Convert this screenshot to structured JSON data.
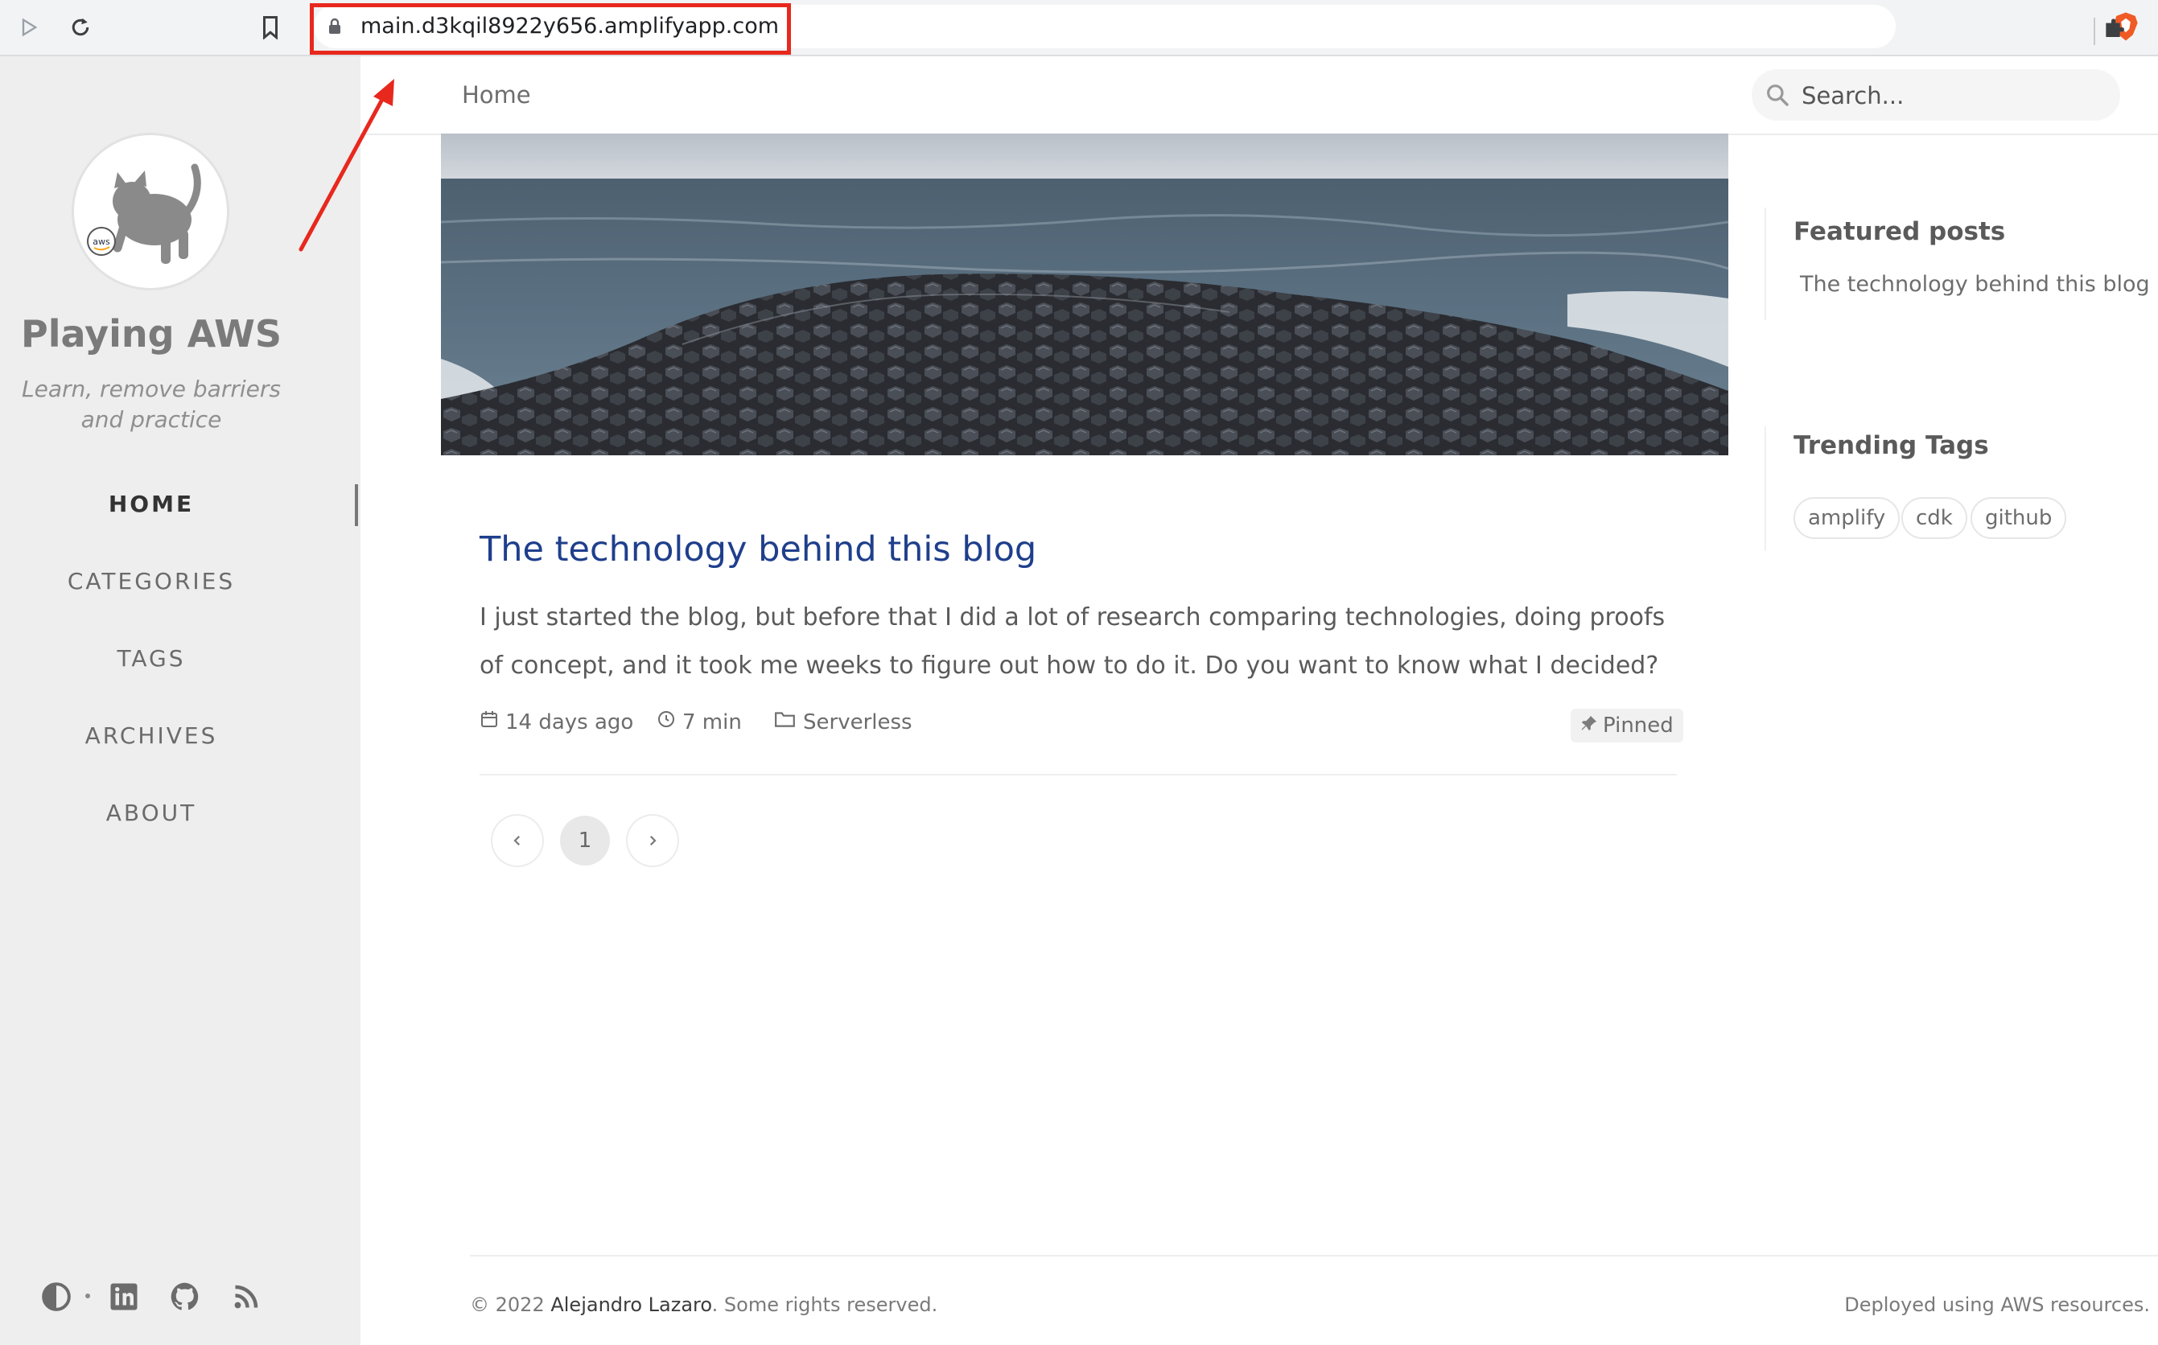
{
  "browser": {
    "url": "main.d3kqil8922y656.amplifyapp.com"
  },
  "sidebar": {
    "title": "Playing AWS",
    "subtitle": "Learn, remove barriers and practice",
    "avatar_badge": "aws",
    "nav": [
      {
        "label": "HOME",
        "active": true
      },
      {
        "label": "CATEGORIES",
        "active": false
      },
      {
        "label": "TAGS",
        "active": false
      },
      {
        "label": "ARCHIVES",
        "active": false
      },
      {
        "label": "ABOUT",
        "active": false
      }
    ],
    "bottom_icons": [
      "theme-toggle-icon",
      "linkedin-icon",
      "github-icon",
      "rss-icon"
    ]
  },
  "topbar": {
    "breadcrumb": "Home",
    "search_placeholder": "Search..."
  },
  "post": {
    "title": "The technology behind this blog",
    "excerpt": "I just started the blog, but before that I did a lot of research comparing technologies, doing proofs of concept, and it took me weeks to figure out how to do it. Do you want to know what I decided?",
    "date": "14 days ago",
    "read_time": "7 min",
    "category": "Serverless",
    "pinned_label": "Pinned"
  },
  "pagination": {
    "current": "1"
  },
  "panel": {
    "featured_heading": "Featured posts",
    "featured_items": [
      "The technology behind this blog"
    ],
    "tags_heading": "Trending Tags",
    "tags": [
      "amplify",
      "cdk",
      "github"
    ]
  },
  "footer": {
    "copyright_prefix": "© 2022 ",
    "author": "Alejandro Lazaro",
    "copyright_suffix": ". Some rights reserved.",
    "right_text": "Deployed using AWS resources."
  },
  "colors": {
    "title_link": "#1f3f8c",
    "annotation": "#e8281d",
    "sidebar_bg": "#eeeeee"
  }
}
